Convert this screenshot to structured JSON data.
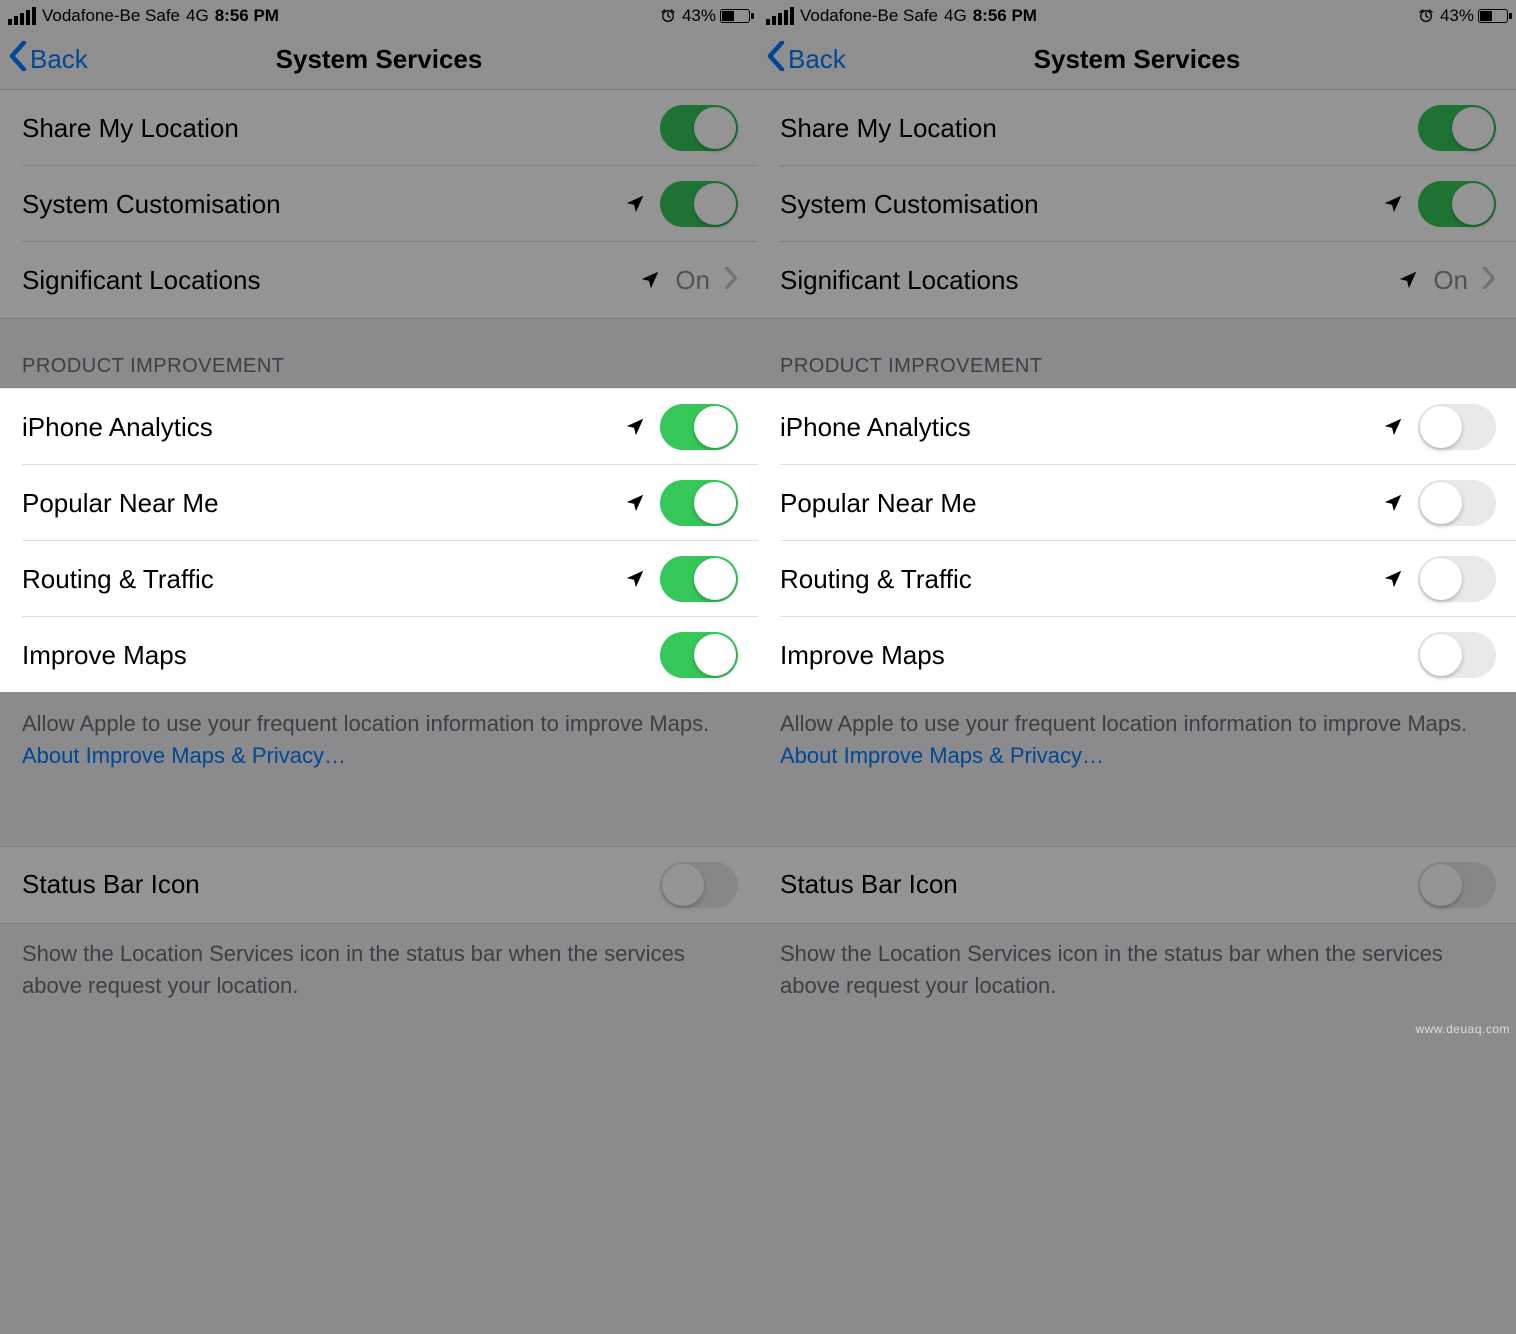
{
  "status": {
    "carrier": "Vodafone-Be Safe",
    "network": "4G",
    "time": "8:56 PM",
    "battery_pct": "43%"
  },
  "nav": {
    "back": "Back",
    "title": "System Services"
  },
  "rows_top": {
    "share_my_location": "Share My Location",
    "system_customisation": "System Customisation",
    "significant_locations": "Significant Locations",
    "significant_locations_value": "On"
  },
  "section_product_improvement": "PRODUCT IMPROVEMENT",
  "rows_pi": {
    "iphone_analytics": "iPhone Analytics",
    "popular_near_me": "Popular Near Me",
    "routing_traffic": "Routing & Traffic",
    "improve_maps": "Improve Maps"
  },
  "footer_improve_maps_text": "Allow Apple to use your frequent location information to improve Maps. ",
  "footer_improve_maps_link": "About Improve Maps & Privacy…",
  "rows_status": {
    "status_bar_icon": "Status Bar Icon"
  },
  "footer_status_bar": "Show the Location Services icon in the status bar when the services above request your location.",
  "left_panel": {
    "toggles": {
      "share_my_location": true,
      "system_customisation": true,
      "iphone_analytics": true,
      "popular_near_me": true,
      "routing_traffic": true,
      "improve_maps": true,
      "status_bar_icon": false
    }
  },
  "right_panel": {
    "toggles": {
      "share_my_location": true,
      "system_customisation": true,
      "iphone_analytics": false,
      "popular_near_me": false,
      "routing_traffic": false,
      "improve_maps": false,
      "status_bar_icon": false
    }
  },
  "watermark": "www.deuaq.com"
}
